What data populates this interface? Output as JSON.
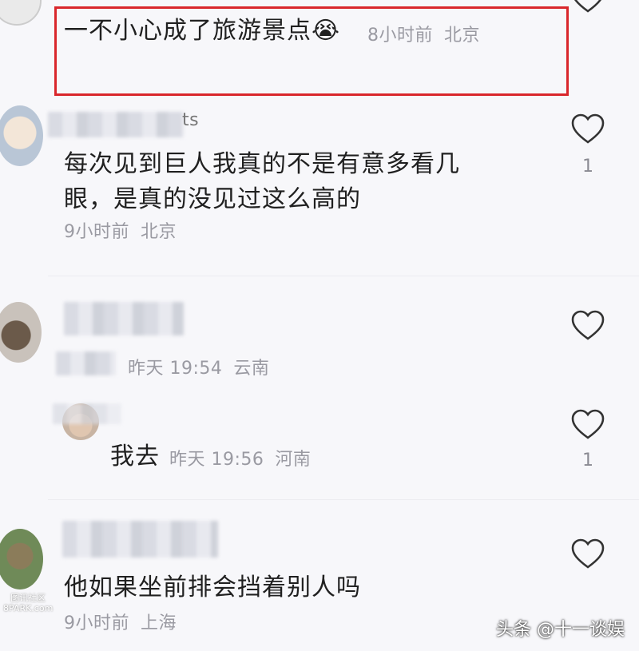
{
  "comments": [
    {
      "text": "一不小心成了旅游景点😭",
      "time": "8小时前",
      "location": "北京"
    },
    {
      "username_suffix": "ts",
      "text_line1": "每次见到巨人我真的不是有意多看几",
      "text_line2": "眼，是真的没见过这么高的",
      "time": "9小时前",
      "location": "北京",
      "likes": "1"
    },
    {
      "time": "昨天 19:54",
      "location": "云南"
    },
    {
      "text": "我去",
      "time": "昨天 19:56",
      "location": "河南",
      "likes": "1"
    },
    {
      "text": "他如果坐前排会挡着别人吗",
      "time": "9小时前",
      "location": "上海"
    }
  ],
  "watermark": {
    "left_line1": "图讯社区",
    "left_line2": "8PARK.com",
    "right": "头条 @十一谈娱"
  },
  "colors": {
    "highlight": "#d9262b",
    "background": "#f7f7fa",
    "meta": "#9a9aa2"
  }
}
